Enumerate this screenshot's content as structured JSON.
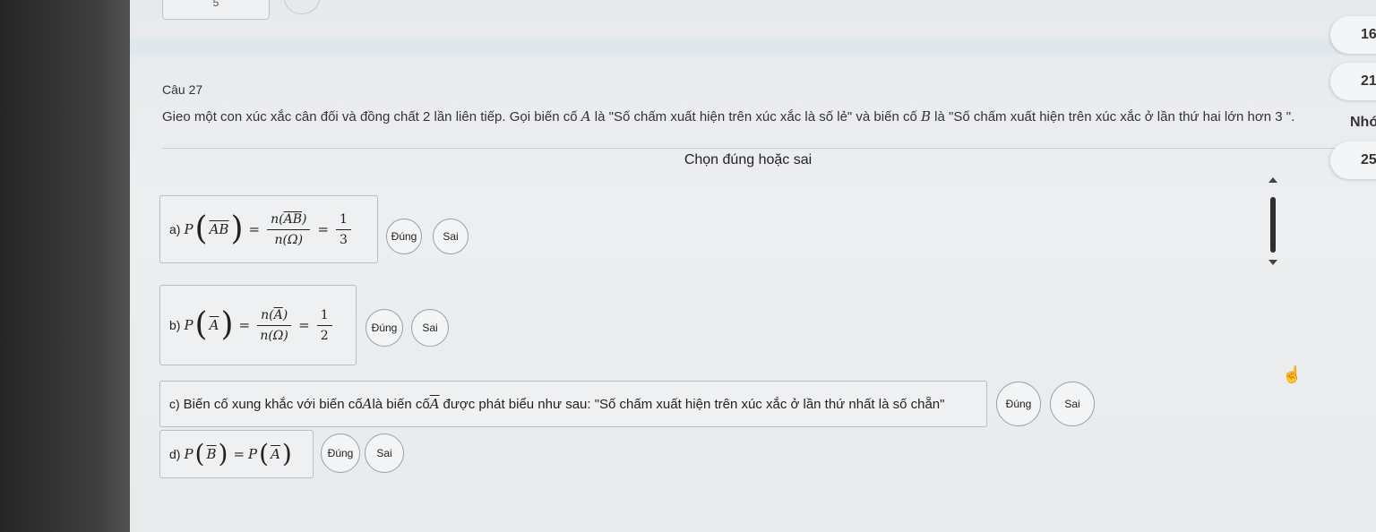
{
  "top": {
    "box_label": "5"
  },
  "question": {
    "number": "Câu 27",
    "text_part1": "Gieo một con xúc xắc cân đối và đồng chất 2 lần liên tiếp. Gọi biến cố ",
    "event_a": "A",
    "text_part2": " là \"Số chấm xuất hiện trên xúc xắc là số lẻ\" và biến cố ",
    "event_b": "B",
    "text_part3": " là \"Số chấm xuất hiện trên xúc xắc ở lần thứ hai lớn hơn 3 \"."
  },
  "instruction": "Chọn đúng hoặc sai",
  "right_panel": {
    "item1": "16",
    "item2": "21",
    "label": "Nhóm",
    "item3": "25"
  },
  "options": [
    {
      "label": "a)",
      "formula": {
        "p": "P",
        "arg": "AB",
        "num_n": "n",
        "num_arg": "AB",
        "den": "n(Ω)",
        "rhs_num": "1",
        "rhs_den": "3"
      },
      "true_label": "Đúng",
      "false_label": "Sai"
    },
    {
      "label": "b)",
      "formula": {
        "p": "P",
        "arg": "A",
        "num_n": "n",
        "num_arg": "A",
        "den": "n(Ω)",
        "rhs_num": "1",
        "rhs_den": "2"
      },
      "true_label": "Đúng",
      "false_label": "Sai"
    },
    {
      "label": "c)",
      "text_part1": "Biến cố xung khắc với biến cố ",
      "event": "A",
      "text_part2": " là biến cố ",
      "event_bar": "A",
      "text_part3": " được phát biểu như sau: \"Số chấm xuất hiện trên xúc xắc ở lần thứ nhất là số chẵn\"",
      "true_label": "Đúng",
      "false_label": "Sai"
    },
    {
      "label": "d)",
      "formula": {
        "p1": "P",
        "arg1": "B",
        "p2": "P",
        "arg2": "A"
      },
      "true_label": "Đúng",
      "false_label": "Sai"
    }
  ]
}
